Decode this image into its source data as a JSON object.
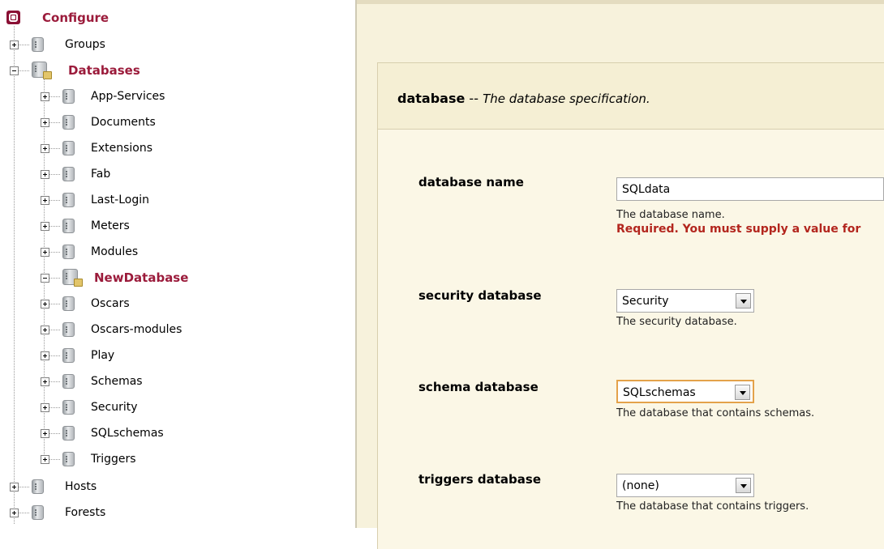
{
  "tree": {
    "root": {
      "label": "Configure"
    },
    "groups": {
      "label": "Groups"
    },
    "databases": {
      "label": "Databases",
      "children": [
        {
          "label": "App-Services",
          "selected": false
        },
        {
          "label": "Documents",
          "selected": false
        },
        {
          "label": "Extensions",
          "selected": false
        },
        {
          "label": "Fab",
          "selected": false
        },
        {
          "label": "Last-Login",
          "selected": false
        },
        {
          "label": "Meters",
          "selected": false
        },
        {
          "label": "Modules",
          "selected": false
        },
        {
          "label": "NewDatabase",
          "selected": true
        },
        {
          "label": "Oscars",
          "selected": false
        },
        {
          "label": "Oscars-modules",
          "selected": false
        },
        {
          "label": "Play",
          "selected": false
        },
        {
          "label": "Schemas",
          "selected": false
        },
        {
          "label": "Security",
          "selected": false
        },
        {
          "label": "SQLschemas",
          "selected": false
        },
        {
          "label": "Triggers",
          "selected": false
        }
      ]
    },
    "hosts": {
      "label": "Hosts"
    },
    "forests": {
      "label": "Forests"
    }
  },
  "panel": {
    "name": "database",
    "separator": "--",
    "description": "The database specification."
  },
  "fields": {
    "database_name": {
      "label": "database name",
      "value": "SQLdata",
      "help": "The database name.",
      "error": "Required. You must supply a value for"
    },
    "security_database": {
      "label": "security database",
      "value": "Security",
      "help": "The security database."
    },
    "schema_database": {
      "label": "schema database",
      "value": "SQLschemas",
      "help": "The database that contains schemas."
    },
    "triggers_database": {
      "label": "triggers database",
      "value": "(none)",
      "help": "The database that contains triggers."
    }
  },
  "colors": {
    "selected_text": "#9b1b3b",
    "error_text": "#b3261e",
    "panel_background": "#f7f2dc",
    "focus_border": "#e4a24a"
  },
  "icons": {
    "root": "configure-icon",
    "node": "database-icon",
    "open_node": "database-folder-icon",
    "expander": "plus-expander-icon",
    "collapser": "minus-expander-icon",
    "dropdown": "chevron-down-icon"
  }
}
